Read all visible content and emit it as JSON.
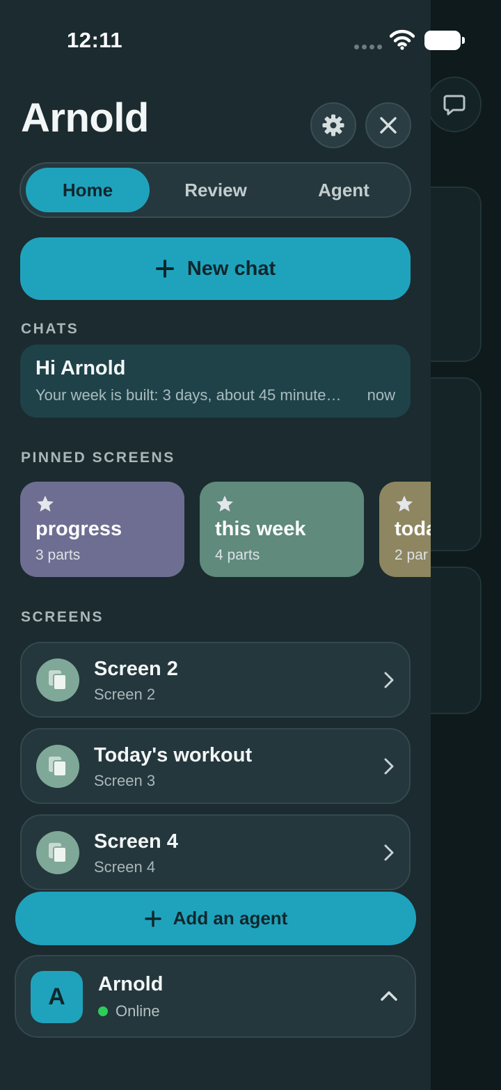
{
  "status_bar": {
    "time": "12:11"
  },
  "header": {
    "title": "Arnold"
  },
  "tabs": [
    {
      "label": "Home",
      "active": true
    },
    {
      "label": "Review",
      "active": false
    },
    {
      "label": "Agent",
      "active": false
    }
  ],
  "new_chat": {
    "label": "New chat"
  },
  "sections": {
    "chats": "CHATS",
    "pinned": "PINNED SCREENS",
    "screens": "SCREENS"
  },
  "chats": [
    {
      "title": "Hi Arnold",
      "preview": "Your week is built: 3 days, about 45 minutes each",
      "time": "now"
    }
  ],
  "pinned_screens": [
    {
      "title": "progress",
      "subtitle": "3 parts",
      "color": "#6e6e92"
    },
    {
      "title": "this week",
      "subtitle": "4 parts",
      "color": "#5f8a7c"
    },
    {
      "title": "toda",
      "subtitle": "2 par",
      "color": "#8e8660"
    }
  ],
  "screens": [
    {
      "title": "Screen 2",
      "subtitle": "Screen 2"
    },
    {
      "title": "Today's workout",
      "subtitle": "Screen 3"
    },
    {
      "title": "Screen 4",
      "subtitle": "Screen 4"
    }
  ],
  "add_agent": {
    "label": "Add an agent"
  },
  "profile": {
    "initial": "A",
    "name": "Arnold",
    "status": "Online"
  },
  "colors": {
    "accent": "#1fa3bd",
    "drawer_bg": "#1b2b2f",
    "online": "#2ecc58"
  },
  "icons": [
    "wifi-icon",
    "battery-icon",
    "gear-icon",
    "close-icon",
    "plus-icon",
    "star-icon",
    "copy-icon",
    "chevron-right-icon",
    "chevron-up-icon",
    "message-icon"
  ]
}
